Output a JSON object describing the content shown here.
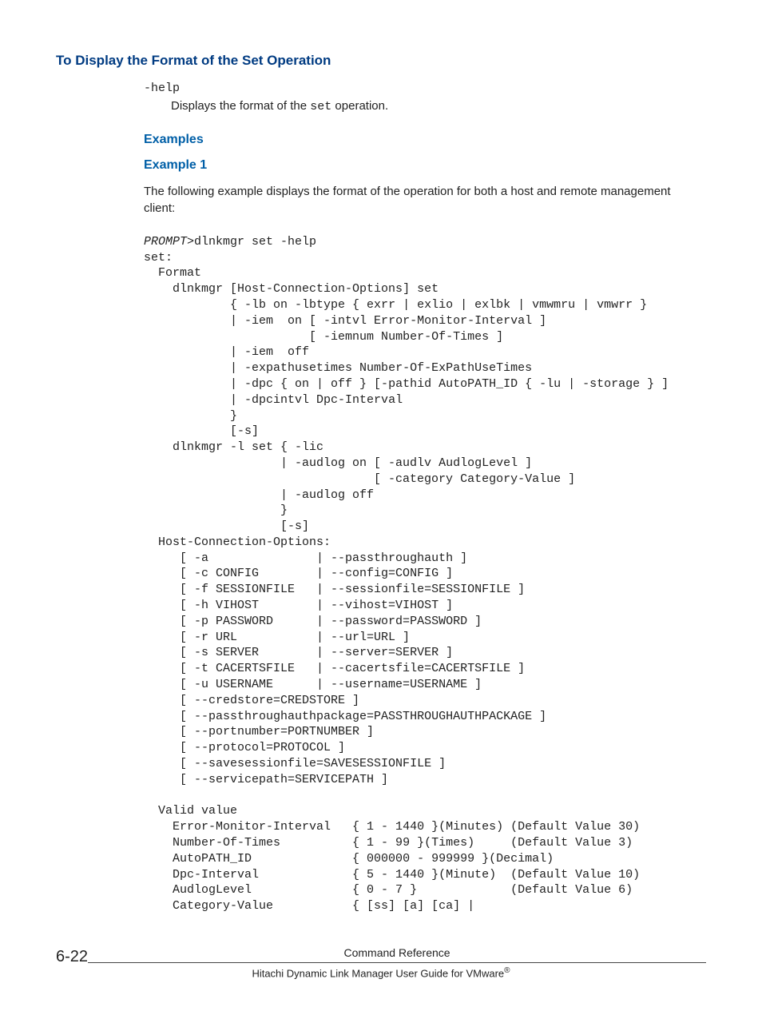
{
  "heading_main": "To Display the Format of the Set Operation",
  "term_help": "-help",
  "desc_prefix": "Displays the format of the ",
  "desc_code": "set",
  "desc_suffix": " operation.",
  "heading_examples": "Examples",
  "heading_example1": "Example 1",
  "example1_intro": "The following example displays the format of the operation for both a host and remote management client:",
  "prompt_label": "PROMPT",
  "code_after_prompt": ">dlnkmgr set -help\nset:\n  Format\n    dlnkmgr [Host-Connection-Options] set\n            { -lb on -lbtype { exrr | exlio | exlbk | vmwmru | vmwrr }\n            | -iem  on [ -intvl Error-Monitor-Interval ]\n                       [ -iemnum Number-Of-Times ]\n            | -iem  off\n            | -expathusetimes Number-Of-ExPathUseTimes\n            | -dpc { on | off } [-pathid AutoPATH_ID { -lu | -storage } ]\n            | -dpcintvl Dpc-Interval\n            }\n            [-s]\n    dlnkmgr -l set { -lic\n                   | -audlog on [ -audlv AudlogLevel ]\n                                [ -category Category-Value ]\n                   | -audlog off\n                   }\n                   [-s]\n  Host-Connection-Options:\n     [ -a               | --passthroughauth ]\n     [ -c CONFIG        | --config=CONFIG ]\n     [ -f SESSIONFILE   | --sessionfile=SESSIONFILE ]\n     [ -h VIHOST        | --vihost=VIHOST ]\n     [ -p PASSWORD      | --password=PASSWORD ]\n     [ -r URL           | --url=URL ]\n     [ -s SERVER        | --server=SERVER ]\n     [ -t CACERTSFILE   | --cacertsfile=CACERTSFILE ]\n     [ -u USERNAME      | --username=USERNAME ]\n     [ --credstore=CREDSTORE ]\n     [ --passthroughauthpackage=PASSTHROUGHAUTHPACKAGE ]\n     [ --portnumber=PORTNUMBER ]\n     [ --protocol=PROTOCOL ]\n     [ --savesessionfile=SAVESESSIONFILE ]\n     [ --servicepath=SERVICEPATH ]\n\n  Valid value\n    Error-Monitor-Interval   { 1 - 1440 }(Minutes) (Default Value 30)\n    Number-Of-Times          { 1 - 99 }(Times)     (Default Value 3)\n    AutoPATH_ID              { 000000 - 999999 }(Decimal)\n    Dpc-Interval             { 5 - 1440 }(Minute)  (Default Value 10)\n    AudlogLevel              { 0 - 7 }             (Default Value 6)\n    Category-Value           { [ss] [a] [ca] |",
  "page_number": "6-22",
  "footer_title": "Command Reference",
  "footer_sub_prefix": "Hitachi Dynamic Link Manager User Guide for VMware",
  "footer_reg": "®"
}
